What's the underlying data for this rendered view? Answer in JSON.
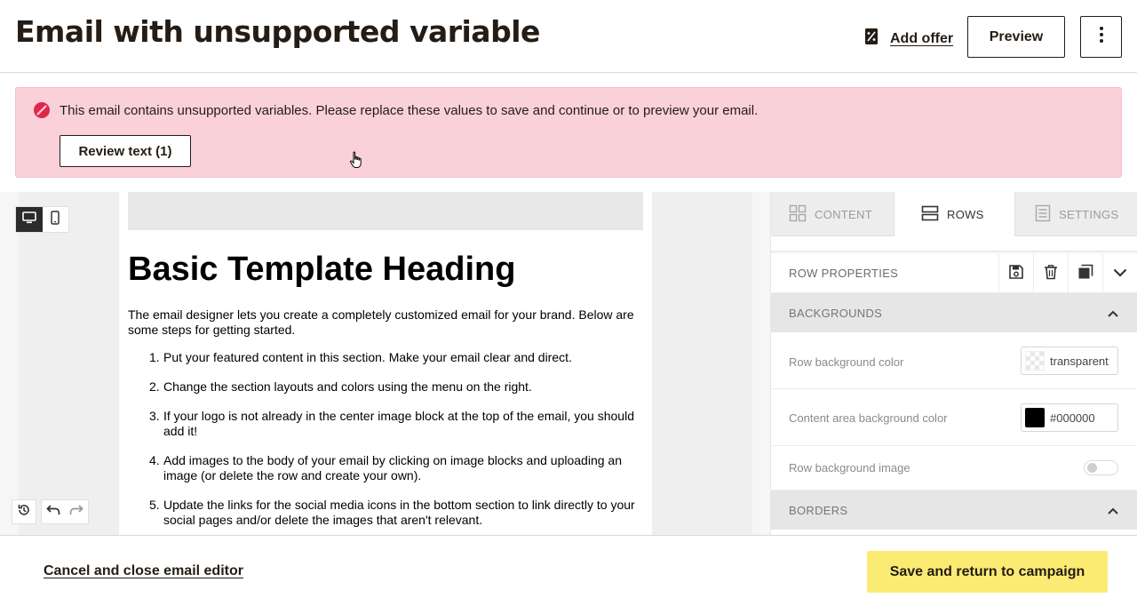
{
  "header": {
    "title": "Email with unsupported variable",
    "add_offer_label": "Add offer",
    "preview_label": "Preview",
    "more_icon": "kebab-menu-icon"
  },
  "alert": {
    "message": "This email contains unsupported variables. Please replace these values to save and continue or to preview your email.",
    "review_button": "Review text (1)",
    "icon": "error-icon"
  },
  "email": {
    "heading": "Basic Template Heading",
    "intro": "The email designer lets you create a completely customized email for your brand. Below are some steps for getting started.",
    "steps": [
      {
        "num": "1.",
        "text": "Put your featured content in this section. Make your email clear and direct."
      },
      {
        "num": "2.",
        "text": "Change the section layouts and colors using the menu on the right."
      },
      {
        "num": "3.",
        "text": "If your logo is not already in the center image block at the top of the email, you should add it!"
      },
      {
        "num": "4.",
        "text": "Add images to the body of your email by clicking on image blocks and uploading an image (or delete the row and create your own)."
      },
      {
        "num": "5.",
        "text": "Update the links for the social media icons in the bottom section to link directly to your social pages and/or delete the images that aren't relevant."
      }
    ]
  },
  "panel": {
    "tabs": [
      {
        "label": "CONTENT",
        "icon": "grid-icon"
      },
      {
        "label": "ROWS",
        "icon": "rows-icon",
        "active": true
      },
      {
        "label": "SETTINGS",
        "icon": "settings-icon"
      }
    ],
    "row_properties_label": "ROW PROPERTIES",
    "backgrounds_label": "BACKGROUNDS",
    "row_bg_color_label": "Row background color",
    "row_bg_color_value": "transparent",
    "content_bg_color_label": "Content area background color",
    "content_bg_color_value": "#000000",
    "row_bg_image_label": "Row background image",
    "borders_label": "BORDERS"
  },
  "footer": {
    "cancel_label": "Cancel and close email editor",
    "save_label": "Save and return to campaign"
  },
  "colors": {
    "alert_bg": "#fbd1d9",
    "error_red": "#e0274a",
    "save_yellow": "#fbeb73",
    "text_dark": "#241c15"
  }
}
